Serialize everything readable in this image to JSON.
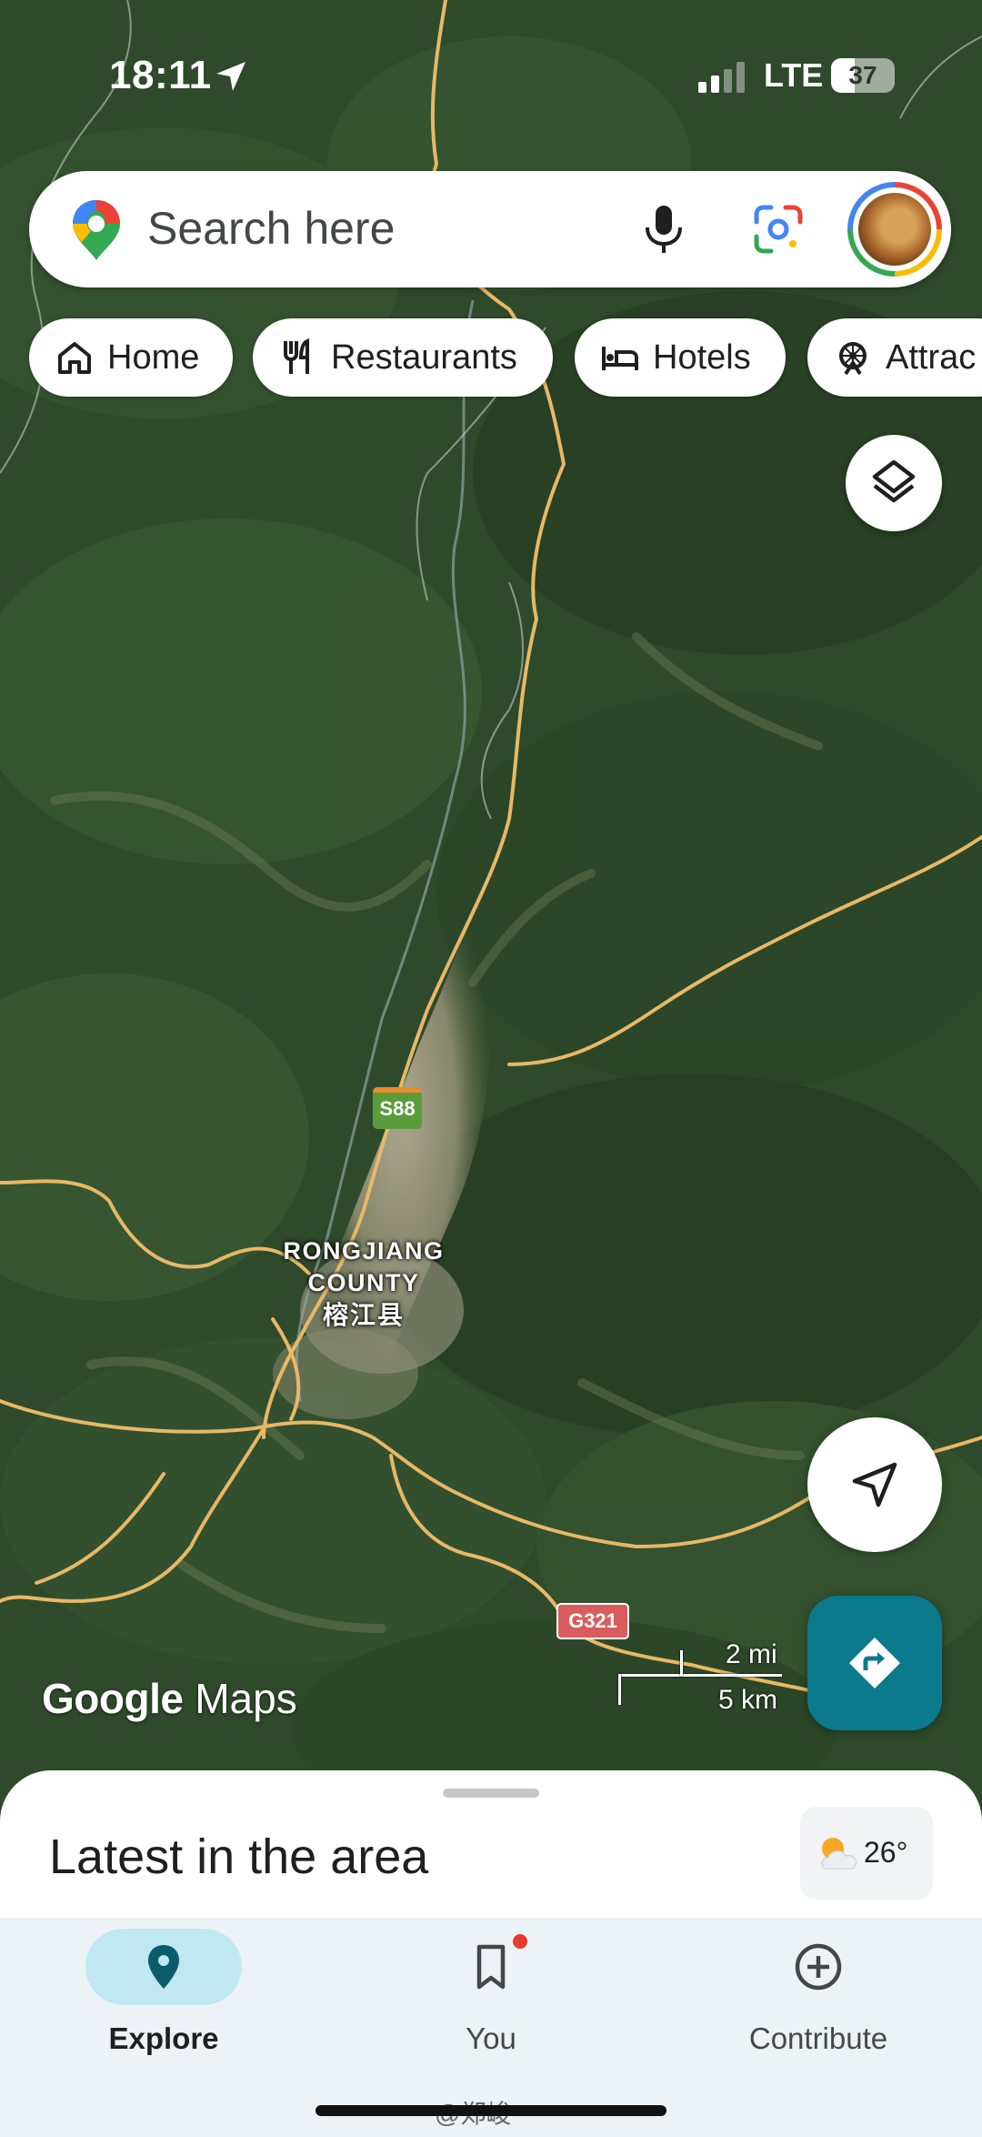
{
  "status_bar": {
    "time": "18:11",
    "network": "LTE",
    "battery": "37",
    "battery_level": 0.37
  },
  "search": {
    "placeholder": "Search here"
  },
  "chips": [
    {
      "label": "Home",
      "icon": "home-icon"
    },
    {
      "label": "Restaurants",
      "icon": "restaurant-icon"
    },
    {
      "label": "Hotels",
      "icon": "hotel-icon"
    },
    {
      "label": "Attrac",
      "icon": "attractions-icon"
    }
  ],
  "map": {
    "place_label_en_1": "RONGJIANG",
    "place_label_en_2": "COUNTY",
    "place_label_zh": "榕江县",
    "road_shield_1": "S88",
    "road_shield_2": "G321",
    "logo_google": "Google",
    "logo_maps": "Maps",
    "scale_mi": "2 mi",
    "scale_km": "5 km"
  },
  "sheet": {
    "title": "Latest in the area",
    "weather": "26°"
  },
  "nav": {
    "items": [
      {
        "label": "Explore",
        "icon": "explore-pin-icon",
        "active": true
      },
      {
        "label": "You",
        "icon": "bookmark-icon",
        "badge": true
      },
      {
        "label": "Contribute",
        "icon": "add-circle-icon"
      }
    ]
  },
  "watermark": "@郑峻",
  "colors": {
    "accent": "#0b7a8c",
    "explore_pill": "#bfe8f2",
    "road": "#e8b866"
  }
}
